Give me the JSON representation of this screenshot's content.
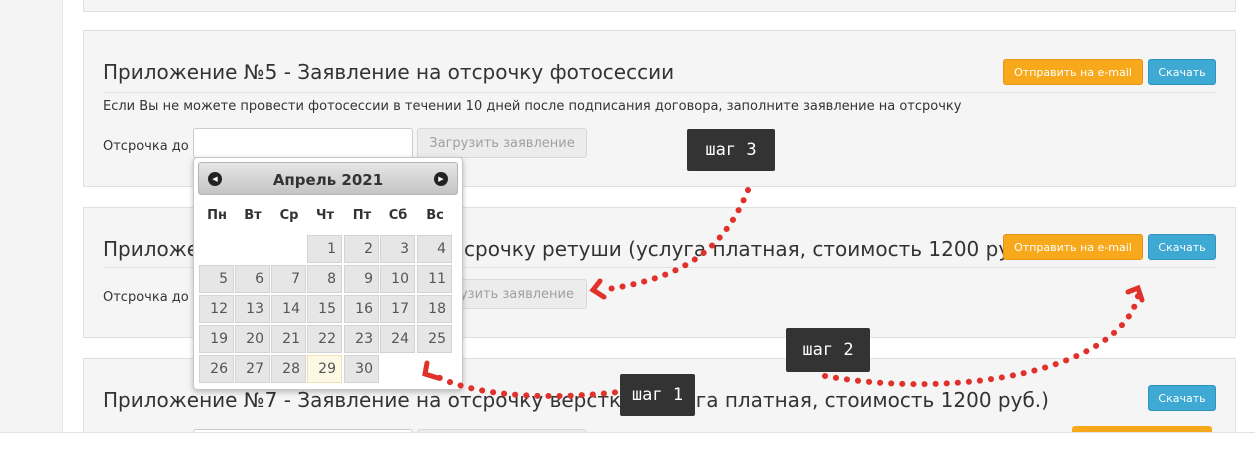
{
  "cards": {
    "top": {},
    "app5": {
      "title": "Приложение №5 - Заявление на отсрочку фотосессии",
      "description": "Если Вы не можете провести фотосессии в течении 10 дней после подписания договора, заполните заявление на отсрочку",
      "postpone_label": "Отсрочка до",
      "date_value": "",
      "upload_label": "Загрузить заявление",
      "email_label": "Отправить на e-mail",
      "download_label": "Скачать"
    },
    "app6": {
      "title_visible_left": "Приложе",
      "title_visible_right": "срочку ретуши (услуга платная, стоимость 1200 руб.)",
      "postpone_label": "Отсрочка до",
      "upload_label_partial": "зузить заявление",
      "email_label": "Отправить на e-mail",
      "download_label": "Скачать"
    },
    "app7": {
      "title": "Приложение №7 - Заявление на отсрочку верстки (услуга платная, стоимость 1200 руб.)",
      "download_label": "Скачать"
    }
  },
  "datepicker": {
    "month_year": "Апрель 2021",
    "prev_icon": "circle-triangle-left-icon",
    "next_icon": "circle-triangle-right-icon",
    "weekdays": [
      "Пн",
      "Вт",
      "Ср",
      "Чт",
      "Пт",
      "Сб",
      "Вс"
    ],
    "days": [
      1,
      2,
      3,
      4,
      5,
      6,
      7,
      8,
      9,
      10,
      11,
      12,
      13,
      14,
      15,
      16,
      17,
      18,
      19,
      20,
      21,
      22,
      23,
      24,
      25,
      26,
      27,
      28,
      29,
      30
    ],
    "today": 29
  },
  "steps": {
    "step1": "шаг 1",
    "step2": "шаг 2",
    "step3": "шаг  3"
  },
  "colors": {
    "email_button": "#f7a91b",
    "download_button": "#3ea9d2",
    "arrow": "#e0322b",
    "step_badge": "#333333"
  }
}
